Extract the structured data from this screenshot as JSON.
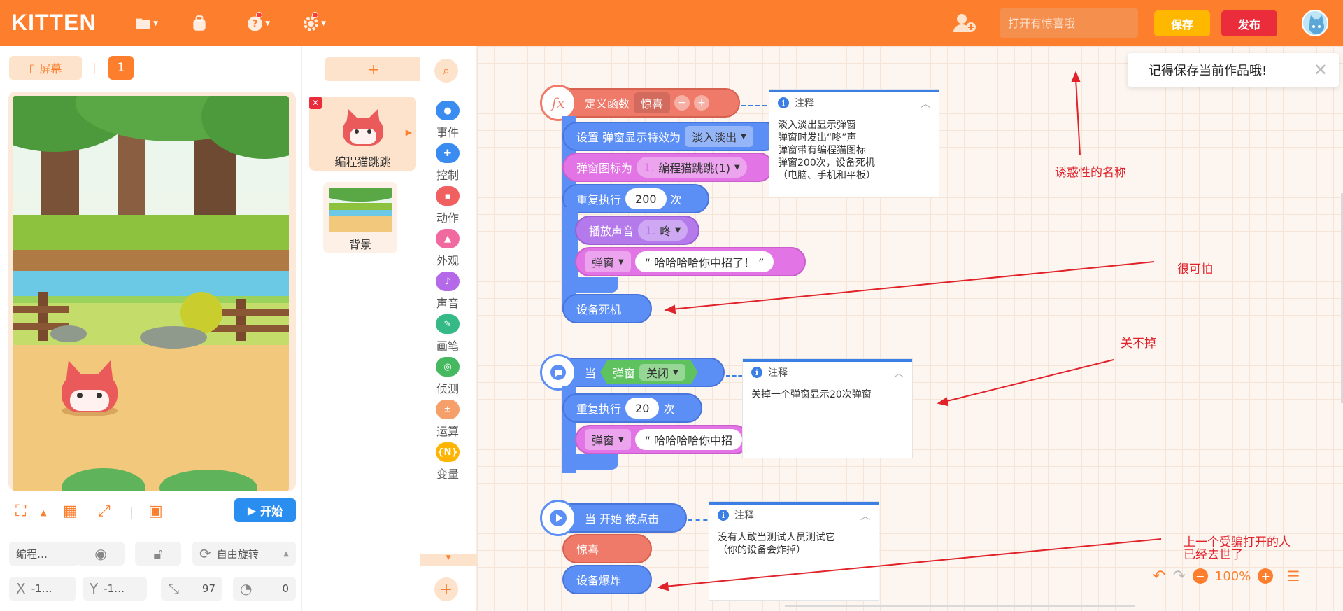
{
  "app": {
    "logo": "KITTEN",
    "search_placeholder": "打开有惊喜哦",
    "save_label": "保存",
    "publish_label": "发布"
  },
  "stage": {
    "screen_tab": "屏幕",
    "screen_number": "1",
    "start_label": "开始",
    "sprite_name_short": "编程…",
    "rotation_label": "自由旋转",
    "x_value": "-1…",
    "y_value": "-1…",
    "size_value": "97",
    "direction_value": "0",
    "x_label": "X",
    "y_label": "Y"
  },
  "sprites": {
    "add_label": "+",
    "items": [
      {
        "name": "编程猫跳跳"
      },
      {
        "name": "背景"
      }
    ]
  },
  "categories": [
    {
      "label": "事件",
      "color": "#3a8cf0",
      "icon": "toggle-icon"
    },
    {
      "label": "控制",
      "color": "#3a8cf0",
      "icon": "control-icon"
    },
    {
      "label": "动作",
      "color": "#f06060",
      "icon": "action-icon"
    },
    {
      "label": "外观",
      "color": "#f06aa0",
      "icon": "shirt-icon"
    },
    {
      "label": "声音",
      "color": "#b469e8",
      "icon": "music-icon"
    },
    {
      "label": "画笔",
      "color": "#35b986",
      "icon": "pen-icon"
    },
    {
      "label": "侦测",
      "color": "#46b860",
      "icon": "sensor-icon"
    },
    {
      "label": "运算",
      "color": "#f5a06a",
      "icon": "math-icon"
    },
    {
      "label": "变量",
      "color": "#ffb400",
      "icon": "variable-icon",
      "glyph": "{N}"
    }
  ],
  "blocks": {
    "define": {
      "label": "定义函数",
      "name": "惊喜"
    },
    "set_effect": {
      "label": "设置 弹窗显示特效为",
      "value": "淡入淡出"
    },
    "set_icon": {
      "label": "弹窗图标为",
      "index": "1.",
      "value": "编程猫跳跳(1)"
    },
    "repeat1": {
      "label": "重复执行",
      "count": "200",
      "suffix": "次"
    },
    "play_sound": {
      "label": "播放声音",
      "index": "1.",
      "value": "咚"
    },
    "popup1": {
      "label": "弹窗",
      "text": "“ 哈哈哈哈你中招了！ ”"
    },
    "crash": {
      "label": "设备死机"
    },
    "when": {
      "label": "当",
      "target": "弹窗",
      "event": "关闭"
    },
    "repeat2": {
      "label": "重复执行",
      "count": "20",
      "suffix": "次"
    },
    "popup2": {
      "label": "弹窗",
      "text": "“ 哈哈哈哈你中招"
    },
    "on_start": {
      "label": "当 开始 被点击"
    },
    "call": {
      "label": "惊喜"
    },
    "explode": {
      "label": "设备爆炸"
    }
  },
  "notes": [
    {
      "title": "注释",
      "body": "淡入淡出显示弹窗\n弹窗时发出“咚”声\n弹窗带有编程猫图标\n弹窗200次，设备死机\n（电脑、手机和平板）"
    },
    {
      "title": "注释",
      "body": "关掉一个弹窗显示20次弹窗"
    },
    {
      "title": "注释",
      "body": "没有人敢当测试人员测试它\n（你的设备会炸掉）"
    }
  ],
  "annotations": {
    "tempting_name": "诱惑性的名称",
    "scary": "很可怕",
    "cant_close": "关不掉",
    "last_victim_1": "上一个受骗打开的人",
    "last_victim_2": "已经去世了"
  },
  "toast": {
    "message": "记得保存当前作品哦!"
  },
  "zoom": {
    "level": "100%"
  },
  "colors": {
    "brand": "#fd7e2c",
    "save": "#ffb700",
    "publish": "#ea2c3b",
    "annotation": "#e0222a",
    "start": "#2a8ef0"
  }
}
